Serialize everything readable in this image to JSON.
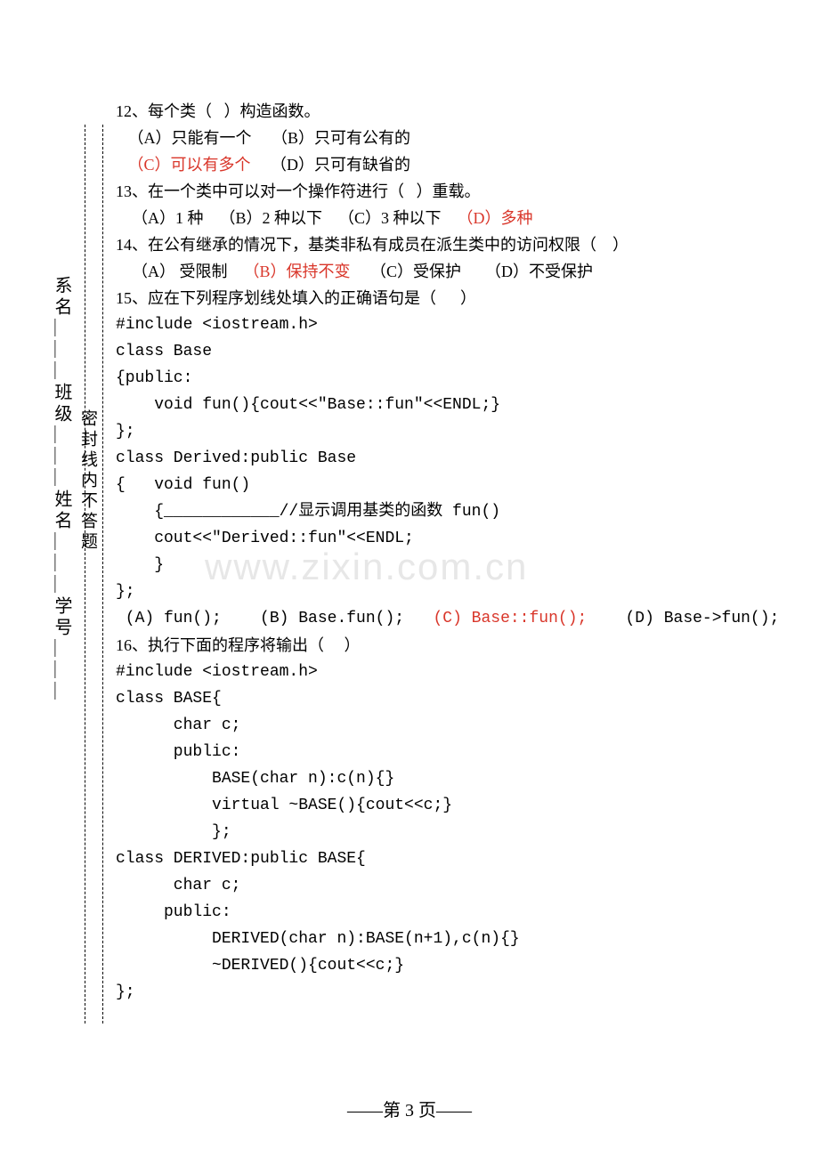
{
  "sidebar": {
    "col1": "系名＿＿＿班级＿＿＿姓名＿＿＿学号＿＿＿",
    "col2": "密封线内不答题"
  },
  "watermark": "www.zixin.com.cn",
  "lines": [
    {
      "t": "12、每个类（   ）构造函数。"
    },
    {
      "t": "   （A）只能有一个     （B）只可有公有的"
    },
    {
      "t": "   （C）可以有多个     （D）只可有缺省的",
      "redParts": [
        "（C）可以有多个"
      ]
    },
    {
      "t": "13、在一个类中可以对一个操作符进行（   ）重载。"
    },
    {
      "t": "    （A）1 种    （B）2 种以下    （C）3 种以下    （D）多种",
      "redParts": [
        "（D）多种"
      ]
    },
    {
      "t": "14、在公有继承的情况下，基类非私有成员在派生类中的访问权限（    ）"
    },
    {
      "t": "    （A） 受限制    （B）保持不变     （C）受保护      （D）不受保护",
      "redParts": [
        "（B）保持不变"
      ]
    },
    {
      "t": "15、应在下列程序划线处填入的正确语句是（      ）"
    },
    {
      "t": "#include <iostream.h>",
      "mono": true
    },
    {
      "t": "class Base",
      "mono": true
    },
    {
      "t": "{public:",
      "mono": true
    },
    {
      "t": "    void fun(){cout<<\"Base::fun\"<<ENDL;}",
      "mono": true
    },
    {
      "t": "};",
      "mono": true
    },
    {
      "t": "class Derived:public Base",
      "mono": true
    },
    {
      "t": "{   void fun()",
      "mono": true
    },
    {
      "t": "    {____________//显示调用基类的函数 fun()",
      "mono": true
    },
    {
      "t": "    cout<<\"Derived::fun\"<<ENDL;",
      "mono": true
    },
    {
      "t": "    }",
      "mono": true
    },
    {
      "t": "};",
      "mono": true
    },
    {
      "t": " (A) fun();    (B) Base.fun();   (C) Base::fun();    (D) Base->fun();",
      "mono": true,
      "redParts": [
        "(C) Base::fun();"
      ]
    },
    {
      "t": "16、执行下面的程序将输出（     ）"
    },
    {
      "t": "#include <iostream.h>",
      "mono": true
    },
    {
      "t": "class BASE{",
      "mono": true
    },
    {
      "t": "      char c;",
      "mono": true
    },
    {
      "t": "      public:",
      "mono": true
    },
    {
      "t": "          BASE(char n):c(n){}",
      "mono": true
    },
    {
      "t": "          virtual ~BASE(){cout<<c;}",
      "mono": true
    },
    {
      "t": "          };",
      "mono": true
    },
    {
      "t": "class DERIVED:public BASE{",
      "mono": true
    },
    {
      "t": "      char c;",
      "mono": true
    },
    {
      "t": "     public:",
      "mono": true
    },
    {
      "t": "          DERIVED(char n):BASE(n+1),c(n){}",
      "mono": true
    },
    {
      "t": "          ~DERIVED(){cout<<c;}",
      "mono": true
    },
    {
      "t": "};",
      "mono": true
    }
  ],
  "footer": "——第 3 页——"
}
